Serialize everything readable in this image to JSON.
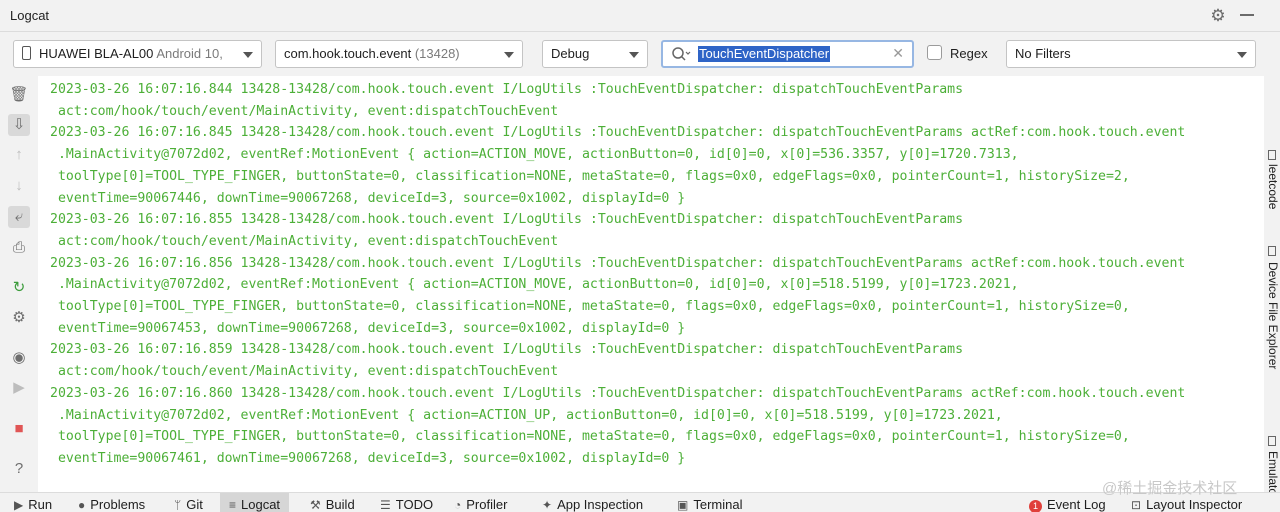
{
  "window": {
    "title": "Logcat",
    "icons": [
      "gear-icon",
      "minimize-icon"
    ]
  },
  "toolbar": {
    "device": {
      "name": "HUAWEI BLA-AL00",
      "os": "Android 10,"
    },
    "process": {
      "name": "com.hook.touch.event",
      "pid": "(13428)"
    },
    "level": "Debug",
    "search": {
      "value": "TouchEventDispatcher"
    },
    "regex_label": "Regex",
    "filter": "No Filters"
  },
  "log_lines": [
    "2023-03-26 16:07:16.844 13428-13428/com.hook.touch.event I/LogUtils :TouchEventDispatcher: dispatchTouchEventParams",
    " act:com/hook/touch/event/MainActivity, event:dispatchTouchEvent",
    "2023-03-26 16:07:16.845 13428-13428/com.hook.touch.event I/LogUtils :TouchEventDispatcher: dispatchTouchEventParams actRef:com.hook.touch.event",
    " .MainActivity@7072d02, eventRef:MotionEvent { action=ACTION_MOVE, actionButton=0, id[0]=0, x[0]=536.3357, y[0]=1720.7313,",
    " toolType[0]=TOOL_TYPE_FINGER, buttonState=0, classification=NONE, metaState=0, flags=0x0, edgeFlags=0x0, pointerCount=1, historySize=2,",
    " eventTime=90067446, downTime=90067268, deviceId=3, source=0x1002, displayId=0 }",
    "2023-03-26 16:07:16.855 13428-13428/com.hook.touch.event I/LogUtils :TouchEventDispatcher: dispatchTouchEventParams",
    " act:com/hook/touch/event/MainActivity, event:dispatchTouchEvent",
    "2023-03-26 16:07:16.856 13428-13428/com.hook.touch.event I/LogUtils :TouchEventDispatcher: dispatchTouchEventParams actRef:com.hook.touch.event",
    " .MainActivity@7072d02, eventRef:MotionEvent { action=ACTION_MOVE, actionButton=0, id[0]=0, x[0]=518.5199, y[0]=1723.2021,",
    " toolType[0]=TOOL_TYPE_FINGER, buttonState=0, classification=NONE, metaState=0, flags=0x0, edgeFlags=0x0, pointerCount=1, historySize=0,",
    " eventTime=90067453, downTime=90067268, deviceId=3, source=0x1002, displayId=0 }",
    "2023-03-26 16:07:16.859 13428-13428/com.hook.touch.event I/LogUtils :TouchEventDispatcher: dispatchTouchEventParams",
    " act:com/hook/touch/event/MainActivity, event:dispatchTouchEvent",
    "2023-03-26 16:07:16.860 13428-13428/com.hook.touch.event I/LogUtils :TouchEventDispatcher: dispatchTouchEventParams actRef:com.hook.touch.event",
    " .MainActivity@7072d02, eventRef:MotionEvent { action=ACTION_UP, actionButton=0, id[0]=0, x[0]=518.5199, y[0]=1723.2021,",
    " toolType[0]=TOOL_TYPE_FINGER, buttonState=0, classification=NONE, metaState=0, flags=0x0, edgeFlags=0x0, pointerCount=1, historySize=0,",
    " eventTime=90067461, downTime=90067268, deviceId=3, source=0x1002, displayId=0 }"
  ],
  "log_color": "#4caf37",
  "left_toolbar": [
    "trash-icon",
    "scroll-to-end-icon",
    "up-arrow-icon",
    "down-arrow-icon",
    "soft-wrap-icon",
    "print-icon",
    "restart-icon",
    "settings-icon",
    "screenshot-icon",
    "screen-record-icon",
    "stop-icon",
    "help-icon"
  ],
  "right_tabs": [
    "leetcode",
    "Device File Explorer",
    "Emulator"
  ],
  "bottom_tabs": {
    "run": "Run",
    "problems": "Problems",
    "git": "Git",
    "logcat": "Logcat",
    "build": "Build",
    "todo": "TODO",
    "profiler": "Profiler",
    "app_inspection": "App Inspection",
    "terminal": "Terminal",
    "event_log": "Event Log",
    "event_log_count": "1",
    "layout_inspector": "Layout Inspector"
  },
  "watermark": "@稀土掘金技术社区"
}
